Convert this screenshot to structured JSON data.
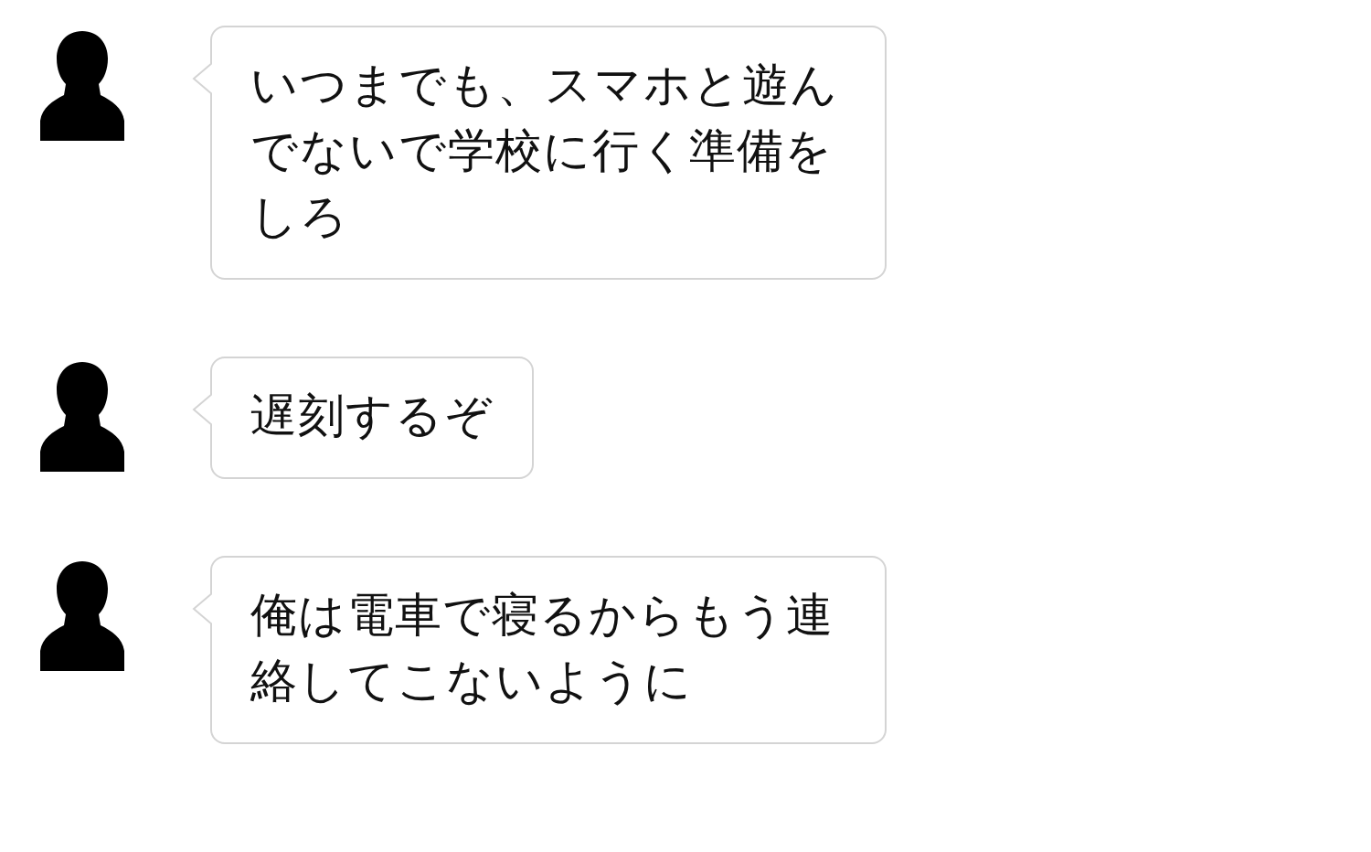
{
  "messages": [
    {
      "text": "いつまでも、スマホと遊んでないで学校に行く準備をしろ"
    },
    {
      "text": "遅刻するぞ"
    },
    {
      "text": "俺は電車で寝るからもう連絡してこないように"
    }
  ]
}
